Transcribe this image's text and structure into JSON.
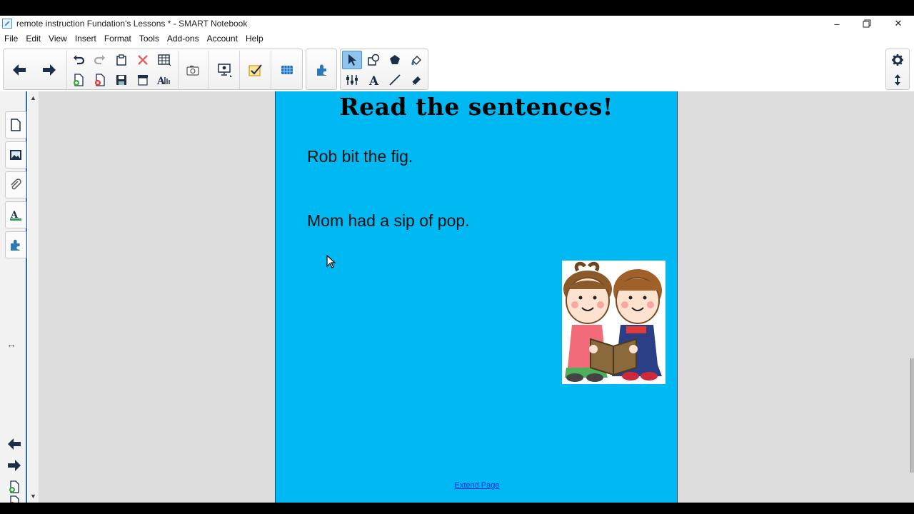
{
  "window": {
    "title": "remote instruction Fundation's Lessons * - SMART Notebook",
    "minimize_glyph": "–",
    "restore_glyph": "❐",
    "close_glyph": "✕"
  },
  "menu": {
    "items": [
      "File",
      "Edit",
      "View",
      "Insert",
      "Format",
      "Tools",
      "Add-ons",
      "Account",
      "Help"
    ]
  },
  "toolbar": {
    "icons": [
      "back-arrow-icon",
      "forward-arrow-icon",
      "undo-icon",
      "redo-icon",
      "paste-icon",
      "delete-icon",
      "table-icon",
      "add-page-icon",
      "delete-page-icon",
      "save-icon",
      "screen-shade-icon",
      "spelling-icon",
      "capture-icon",
      "display-icon",
      "response-icon",
      "document-camera-icon",
      "addons-icon",
      "select-icon",
      "shapes-icon",
      "polygon-icon",
      "fill-icon",
      "properties-icon",
      "text-icon",
      "line-icon",
      "eraser-icon",
      "settings-icon",
      "toolbar-position-icon"
    ],
    "accent_color": "#1f6fb8",
    "selected_color": "#8fc4ee"
  },
  "sidebar": {
    "tabs": [
      "page-sorter-icon",
      "gallery-icon",
      "attachments-icon",
      "properties-icon",
      "addons-icon"
    ],
    "resize_glyph": "↔"
  },
  "page": {
    "background_color": "#00b9f2",
    "title": "Read the sentences!",
    "sentence_1": "Rob bit the fig.",
    "sentence_2": "Mom had a sip of pop.",
    "image": "children-reading-book-clipart",
    "extend_link": "Extend Page"
  }
}
